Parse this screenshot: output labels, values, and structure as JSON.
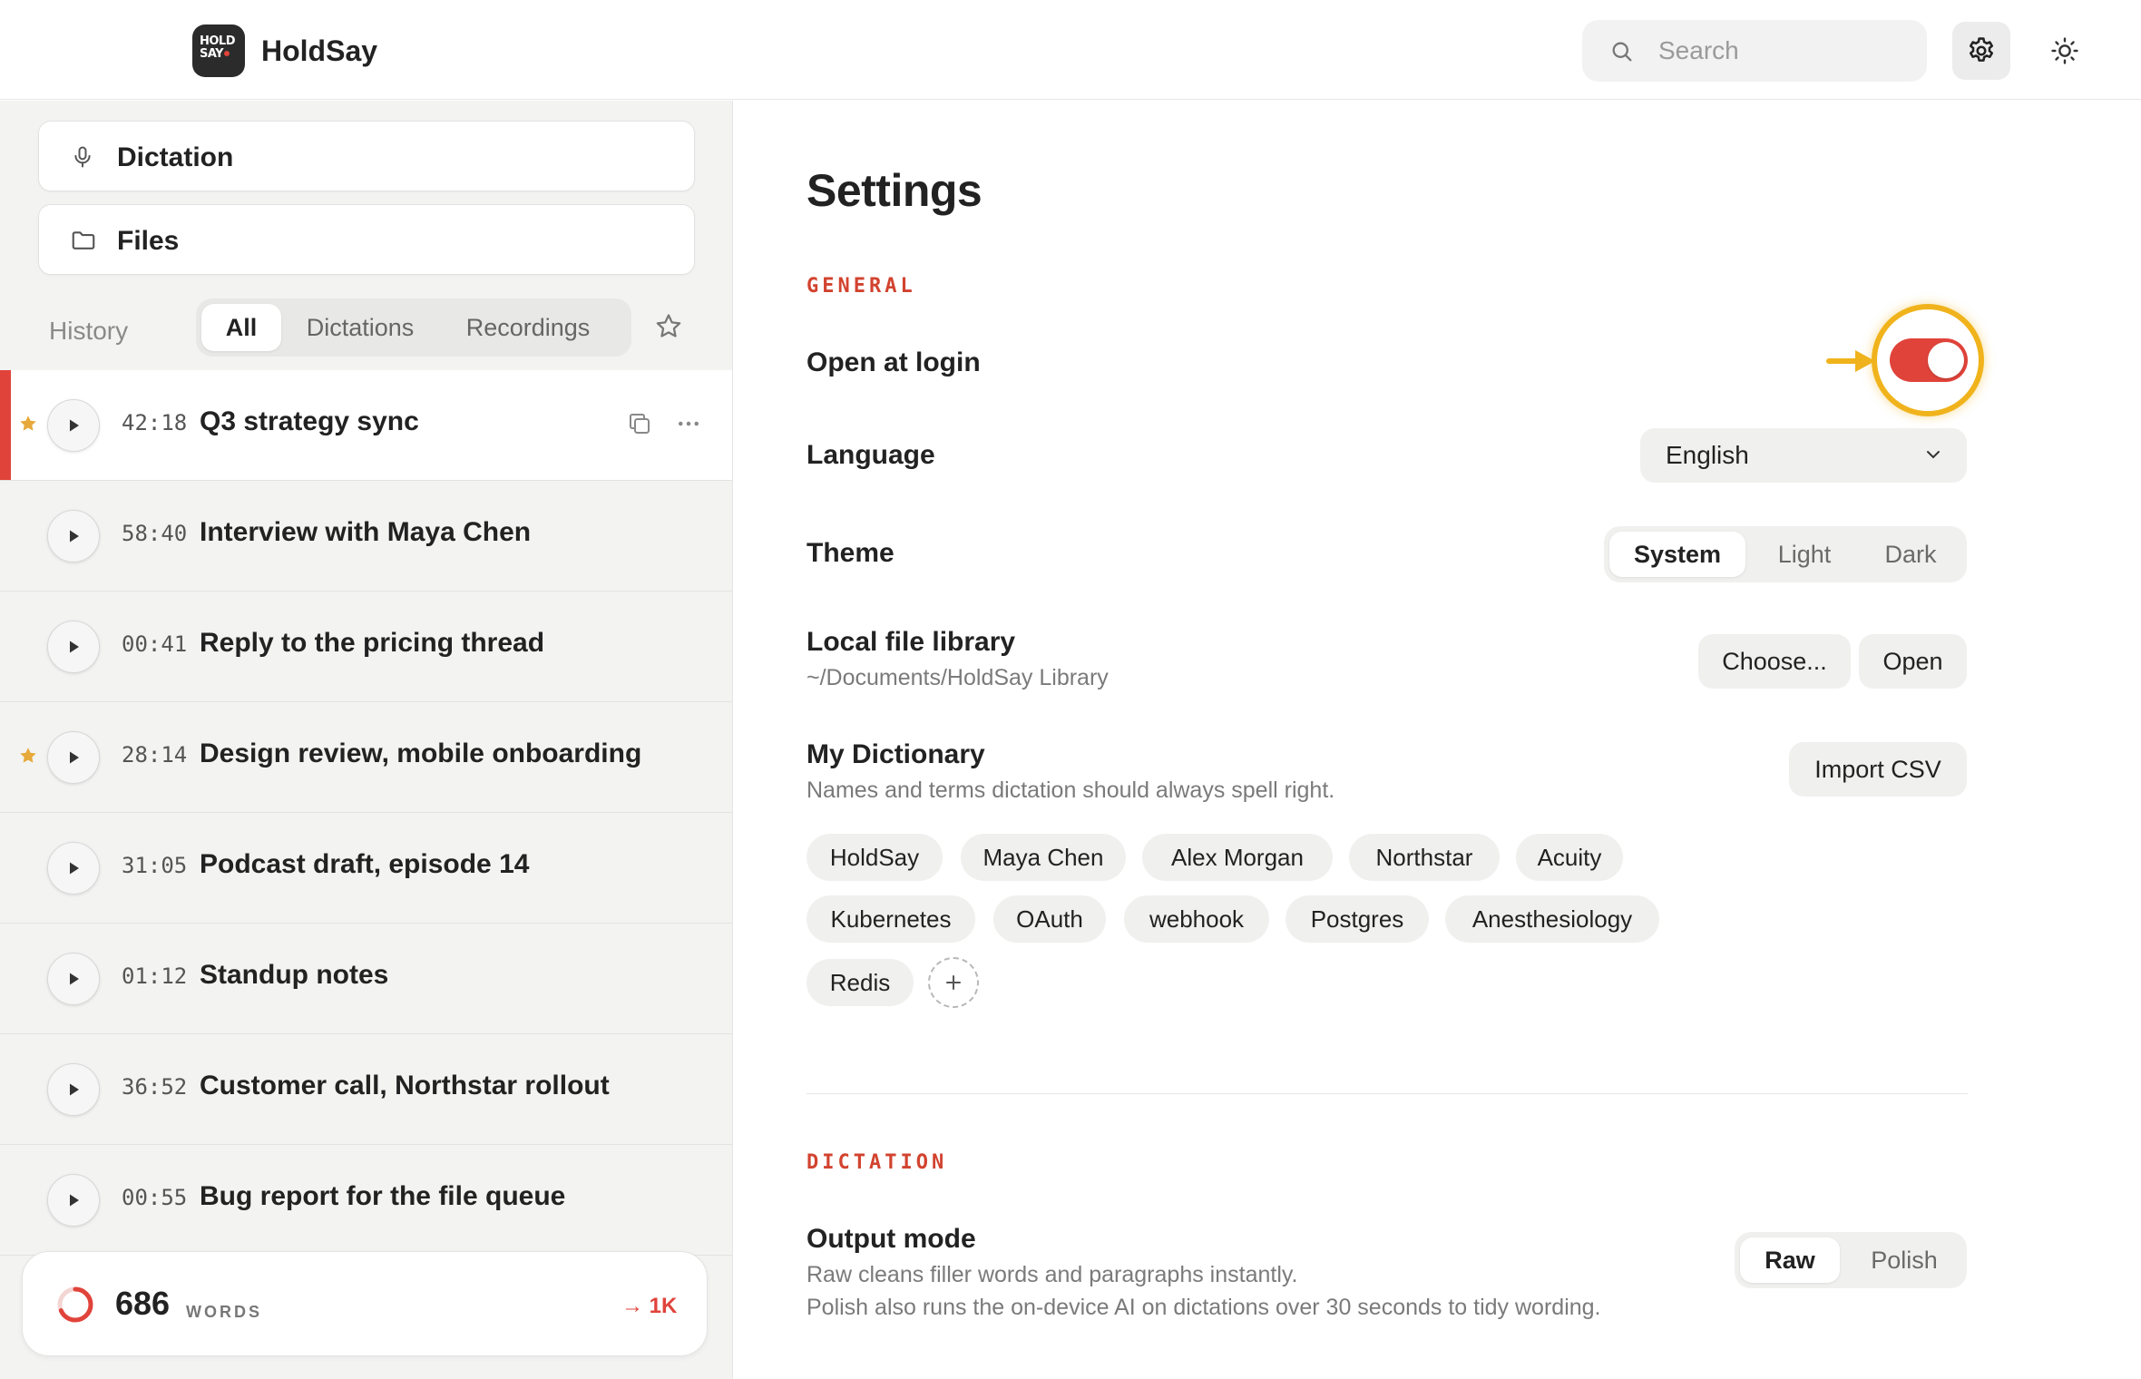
{
  "app": {
    "logo_line1": "HOLD",
    "logo_line2": "SAY",
    "title": "HoldSay"
  },
  "header": {
    "search_placeholder": "Search",
    "icons": [
      "search-icon",
      "gear-icon",
      "sun-icon"
    ]
  },
  "sidebar": {
    "nav": [
      {
        "label": "Dictation",
        "icon": "microphone-icon"
      },
      {
        "label": "Files",
        "icon": "folder-icon"
      }
    ],
    "history_label": "History",
    "filters": [
      {
        "label": "All",
        "active": true
      },
      {
        "label": "Dictations",
        "active": false
      },
      {
        "label": "Recordings",
        "active": false
      }
    ],
    "items": [
      {
        "duration": "42:18",
        "title": "Q3 strategy sync",
        "starred": true,
        "selected": true
      },
      {
        "duration": "58:40",
        "title": "Interview with Maya Chen",
        "starred": false,
        "selected": false
      },
      {
        "duration": "00:41",
        "title": "Reply to the pricing thread",
        "starred": false,
        "selected": false
      },
      {
        "duration": "28:14",
        "title": "Design review, mobile onboarding",
        "starred": true,
        "selected": false
      },
      {
        "duration": "31:05",
        "title": "Podcast draft, episode 14",
        "starred": false,
        "selected": false
      },
      {
        "duration": "01:12",
        "title": "Standup notes",
        "starred": false,
        "selected": false
      },
      {
        "duration": "36:52",
        "title": "Customer call, Northstar rollout",
        "starred": false,
        "selected": false
      },
      {
        "duration": "00:55",
        "title": "Bug report for the file queue",
        "starred": false,
        "selected": false
      }
    ],
    "words": {
      "count": "686",
      "label": "WORDS",
      "goal": "→ 1K",
      "progress": 0.686
    }
  },
  "settings": {
    "title": "Settings",
    "general_label": "GENERAL",
    "open_at_login": {
      "label": "Open at login",
      "enabled": true
    },
    "language": {
      "label": "Language",
      "value": "English"
    },
    "theme": {
      "label": "Theme",
      "options": [
        "System",
        "Light",
        "Dark"
      ],
      "selected": "System"
    },
    "library": {
      "label": "Local file library",
      "path": "~/Documents/HoldSay Library",
      "choose_label": "Choose...",
      "open_label": "Open"
    },
    "dictionary": {
      "label": "My Dictionary",
      "description": "Names and terms dictation should always spell right.",
      "import_label": "Import CSV",
      "terms": [
        "HoldSay",
        "Maya Chen",
        "Alex Morgan",
        "Northstar",
        "Acuity",
        "Kubernetes",
        "OAuth",
        "webhook",
        "Postgres",
        "Anesthesiology",
        "Redis"
      ]
    },
    "dictation_label": "DICTATION",
    "output_mode": {
      "label": "Output mode",
      "desc1": "Raw cleans filler words and paragraphs instantly.",
      "desc2": "Polish also runs the on-device AI on dictations over 30 seconds to tidy wording.",
      "options": [
        "Raw",
        "Polish"
      ],
      "selected": "Raw"
    }
  },
  "colors": {
    "accent": "#e0433a",
    "section": "#d2432f",
    "highlight": "#f0b31c",
    "star": "#e6a93a"
  }
}
